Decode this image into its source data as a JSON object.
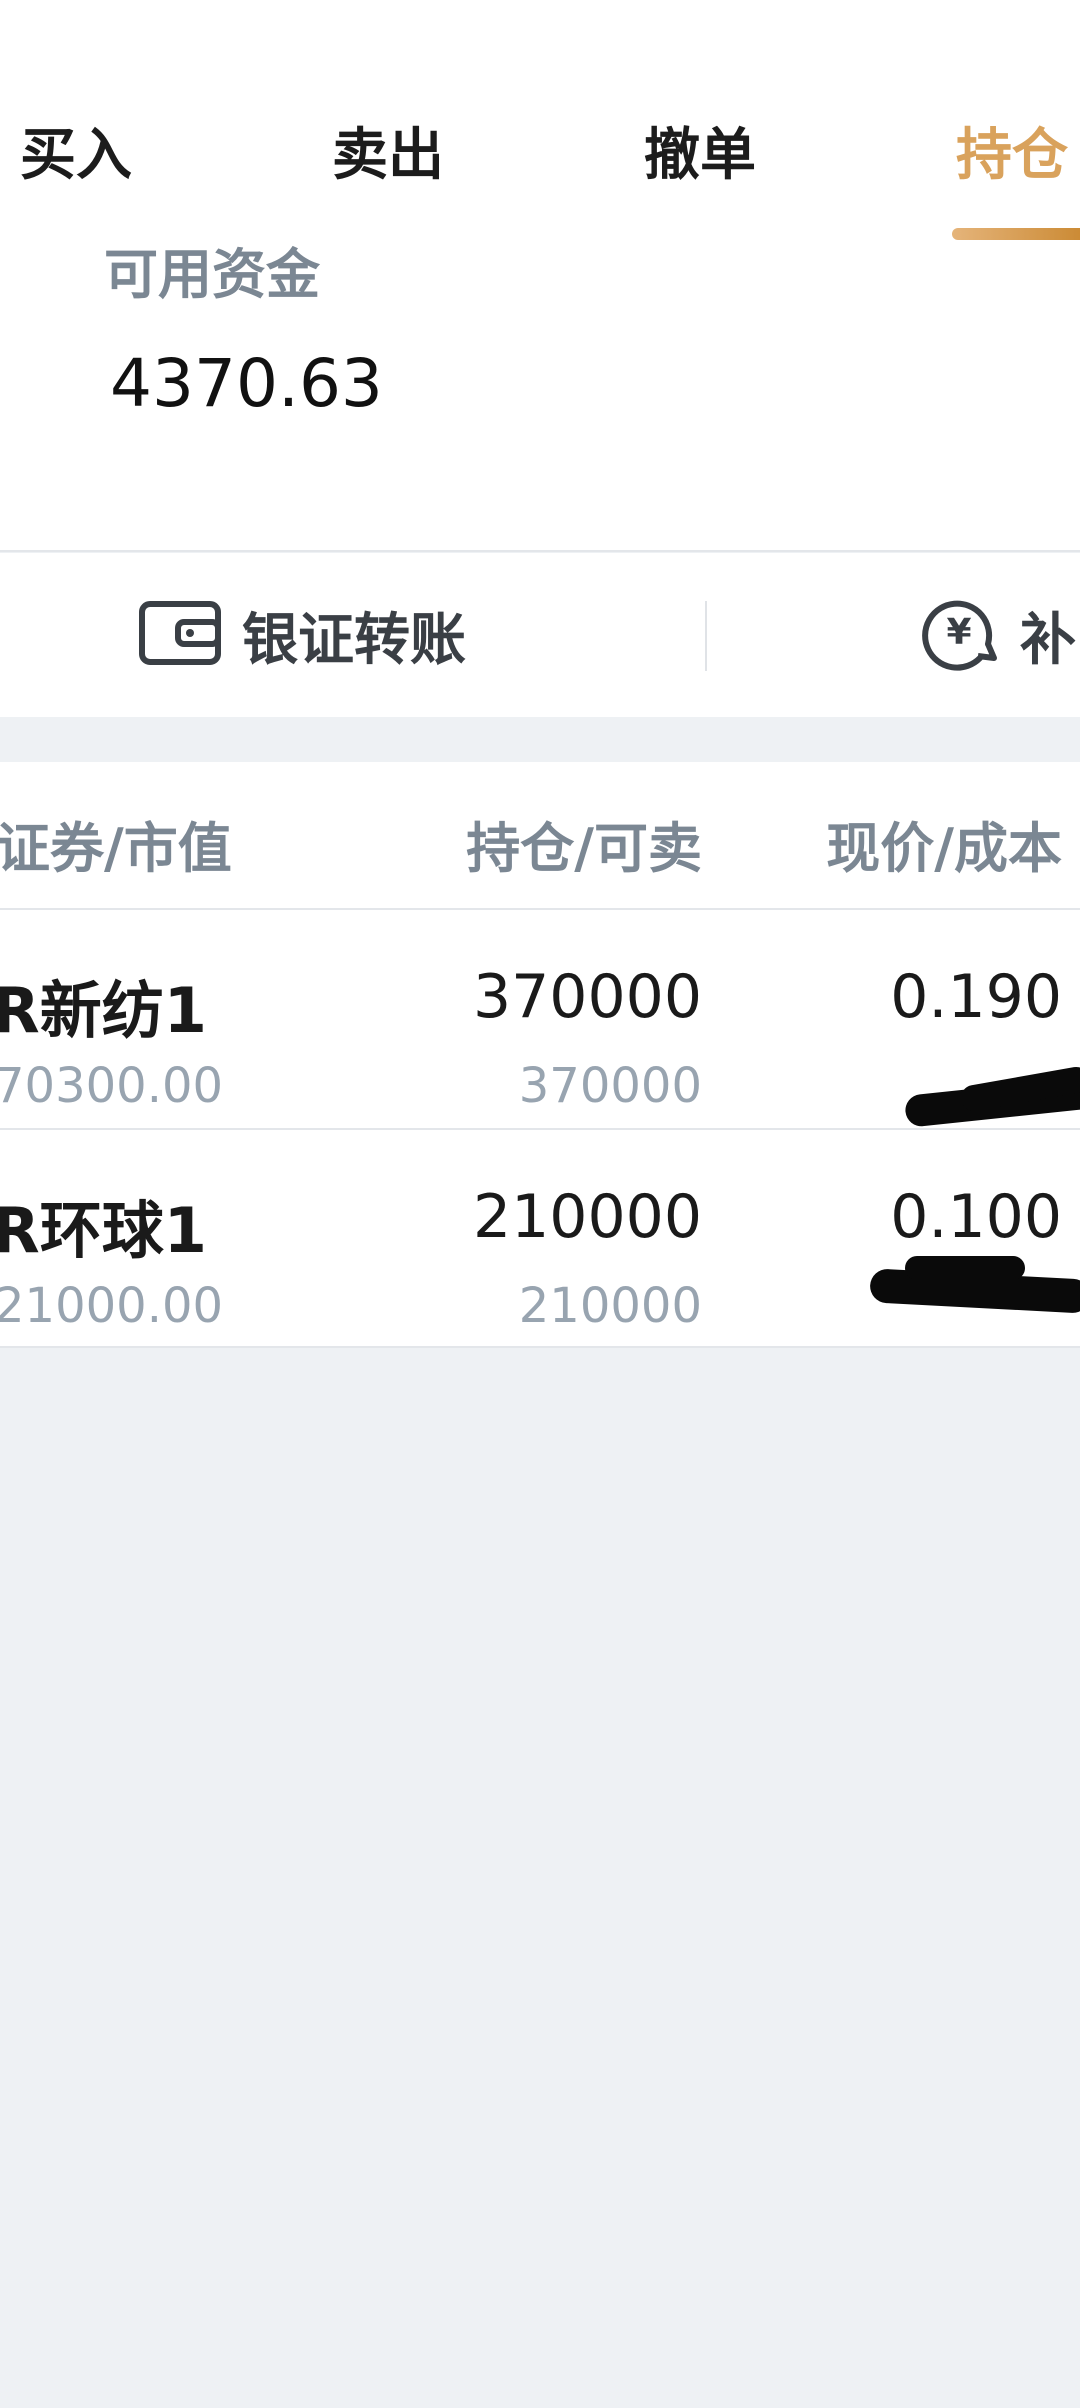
{
  "tabs": [
    {
      "label": "买入"
    },
    {
      "label": "卖出"
    },
    {
      "label": "撤单"
    },
    {
      "label": "持仓",
      "active": true
    }
  ],
  "funds": {
    "label": "可用资金",
    "value": "4370.63"
  },
  "actions": [
    {
      "label": "银证转账",
      "icon": "wallet-icon"
    },
    {
      "label": "补",
      "icon": "yen-circle-icon"
    }
  ],
  "holdings": {
    "headers": {
      "security": "证券/市值",
      "position": "持仓/可卖",
      "price": "现价/成本"
    },
    "rows": [
      {
        "name": "R新纺1",
        "market_value": "70300.00",
        "position": "370000",
        "sellable": "370000",
        "price": "0.190"
      },
      {
        "name": "R环球1",
        "market_value": "21000.00",
        "position": "210000",
        "sellable": "210000",
        "price": "0.100"
      }
    ]
  },
  "colors": {
    "accent": "#d9a25c",
    "label_gray": "#7b8793",
    "sub_gray": "#98a4b0",
    "background": "#eef1f4"
  }
}
